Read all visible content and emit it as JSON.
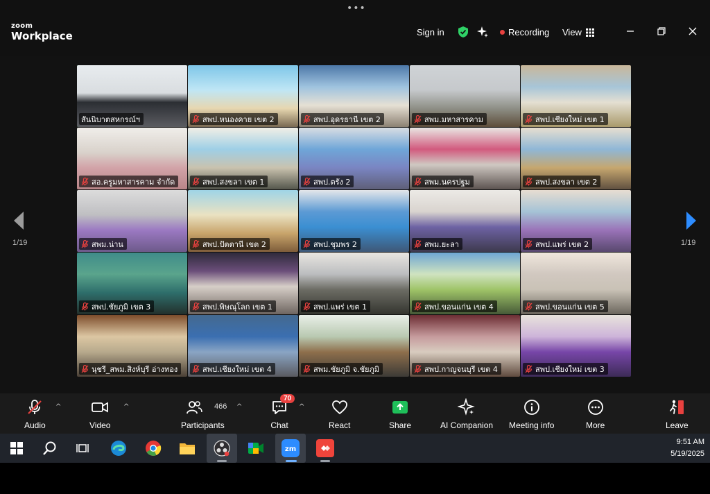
{
  "app": {
    "logo_small": "zoom",
    "logo_main": "Workplace"
  },
  "header": {
    "signin_label": "Sign in",
    "recording_label": "Recording",
    "view_label": "View"
  },
  "pager": {
    "left": "1/19",
    "right": "1/19"
  },
  "tiles": [
    {
      "label": "สันนิบาตสหกรณ์ฯ",
      "muted": false,
      "active": true
    },
    {
      "label": "สพป.หนองคาย เขต 2",
      "muted": true
    },
    {
      "label": "สพป.อุดรธานี เขต 2",
      "muted": true
    },
    {
      "label": "สพม.มหาสารคาม",
      "muted": true
    },
    {
      "label": "สพป.เชียงใหม่ เขต 1",
      "muted": true
    },
    {
      "label": "สอ.ครูมหาสารคาม จำกัด",
      "muted": true
    },
    {
      "label": "สพป.สงขลา เขต 1",
      "muted": true
    },
    {
      "label": "สพป.ตรัง 2",
      "muted": true
    },
    {
      "label": "สพม.นครปฐม",
      "muted": true
    },
    {
      "label": "สพป.สงขลา เขต 2",
      "muted": true
    },
    {
      "label": "สพม.น่าน",
      "muted": true
    },
    {
      "label": "สพป.ปัตตานี เขต 2",
      "muted": true
    },
    {
      "label": "สพป.ชุมพร 2",
      "muted": true
    },
    {
      "label": "สพม.ยะลา",
      "muted": true
    },
    {
      "label": "สพป.แพร่ เขต 2",
      "muted": true
    },
    {
      "label": "สพป.ชัยภูมิ เขต 3",
      "muted": true
    },
    {
      "label": "สพป.พิษณุโลก เขต 1",
      "muted": true
    },
    {
      "label": "สพป.แพร่ เขต 1",
      "muted": true
    },
    {
      "label": "สพป.ขอนแก่น เขต 4",
      "muted": true
    },
    {
      "label": "สพป.ขอนแก่น เขต 5",
      "muted": true
    },
    {
      "label": "นุชรี_สพม.สิงห์บุรี อ่างทอง",
      "muted": true
    },
    {
      "label": "สพป.เชียงใหม่ เขต 4",
      "muted": true
    },
    {
      "label": "สพม.ชัยภูมิ จ.ชัยภูมิ",
      "muted": true
    },
    {
      "label": "สพป.กาญจนบุรี เขต 4",
      "muted": true
    },
    {
      "label": "สพป.เชียงใหม่ เขต 3",
      "muted": true
    }
  ],
  "toolbar": {
    "audio": "Audio",
    "video": "Video",
    "participants": "Participants",
    "participants_count": "466",
    "chat": "Chat",
    "chat_badge": "70",
    "react": "React",
    "share": "Share",
    "ai_companion": "AI Companion",
    "meeting_info": "Meeting info",
    "more": "More",
    "leave": "Leave"
  },
  "taskbar": {
    "time": "9:51 AM",
    "date": "5/19/2025",
    "icons": [
      "windows-start-icon",
      "search-icon",
      "task-view-icon",
      "edge-icon",
      "chrome-icon",
      "file-explorer-icon",
      "obs-icon",
      "google-meet-icon",
      "zoom-icon",
      "anydesk-icon"
    ]
  },
  "colors": {
    "accent_green": "#2fd267",
    "record_red": "#e8413f",
    "share_green": "#1fbf5a"
  }
}
